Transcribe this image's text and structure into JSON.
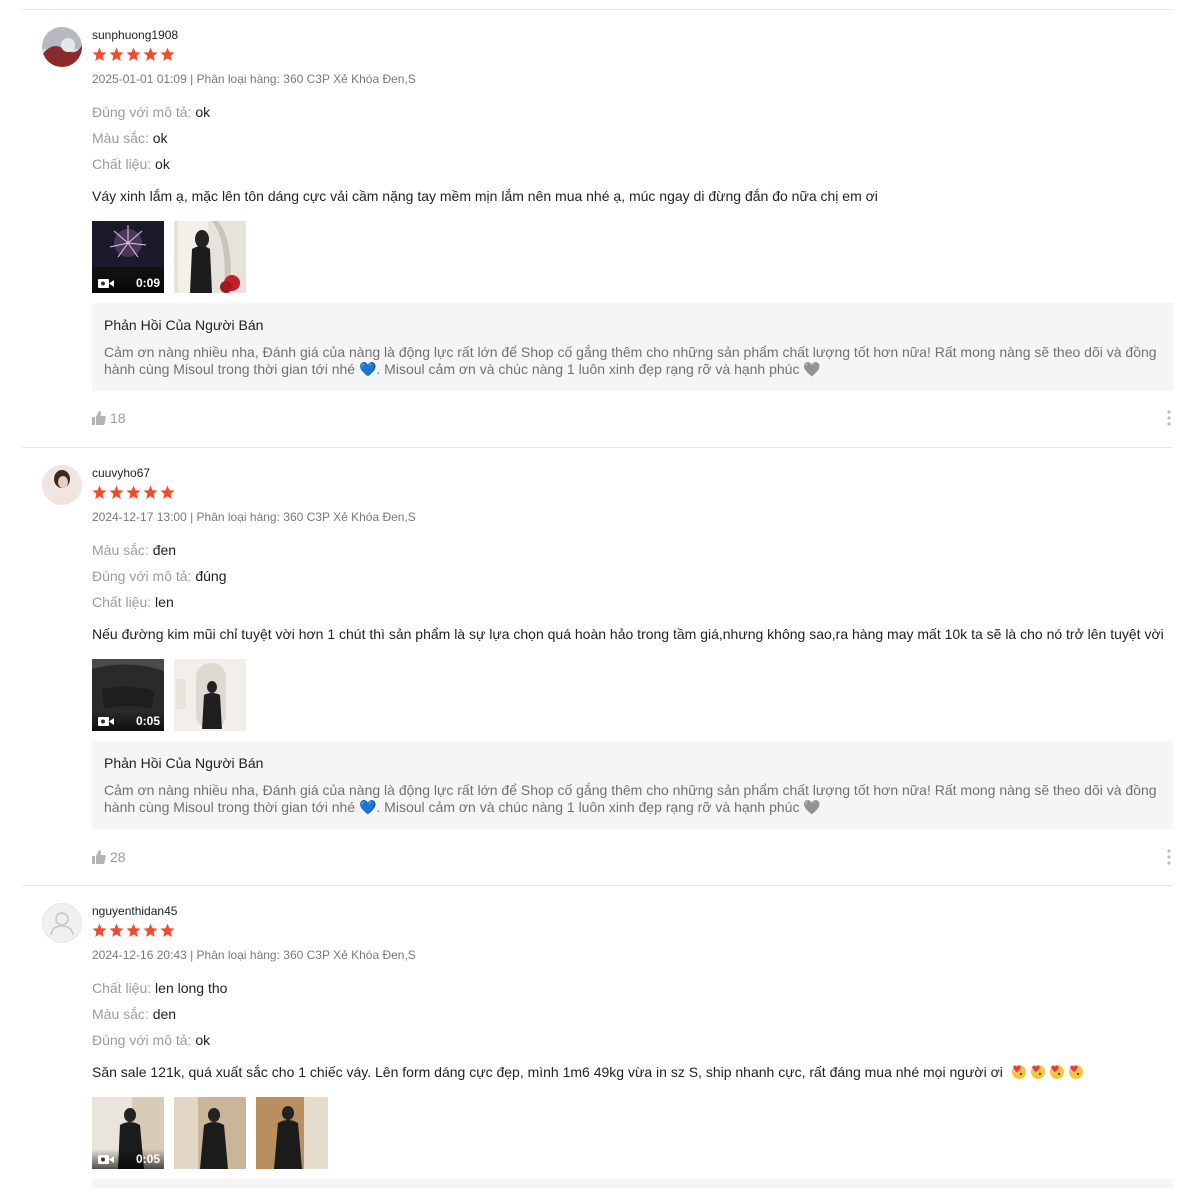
{
  "colors": {
    "star": "#ee4d2d",
    "text": "#222222",
    "muted": "#8a8a8a",
    "reply_bg": "#f5f5f5"
  },
  "reviews": [
    {
      "username": "sunphuong1908",
      "rating": 5,
      "meta": "2025-01-01 01:09 | Phân loại hàng: 360 C3P Xẻ Khóa Đen,S",
      "attributes": [
        {
          "label": "Đúng với mô tả: ",
          "value": "ok"
        },
        {
          "label": "Màu sắc: ",
          "value": "ok"
        },
        {
          "label": "Chất liệu: ",
          "value": "ok"
        }
      ],
      "comment": "Váy xinh lắm ạ, mặc lên tôn dáng cực vải cầm nặng tay mềm mịn lắm nên mua nhé ạ, múc ngay di đừng đắn đo nữa chị em ơi",
      "video_duration": "0:09",
      "media_count": 2,
      "reply": {
        "title": "Phản Hồi Của Người Bán",
        "line1": "Cảm ơn nàng nhiều nha, Đánh giá của nàng là động lực rất lớn để Shop cố gắng thêm cho những sản phẩm chất lượng tốt hơn nữa! Rất mong nàng sẽ theo dõi và đồng",
        "line2a": "hành cùng Misoul trong thời gian tới nhé ",
        "line2b": ". Misoul cảm ơn và chúc nàng 1 luôn xinh đẹp rạng rỡ và hạnh phúc ",
        "heart_blue": "💙",
        "heart_black": "🖤"
      },
      "likes": "18"
    },
    {
      "username": "cuuvyho67",
      "rating": 5,
      "meta": "2024-12-17 13:00 | Phân loại hàng: 360 C3P Xẻ Khóa Đen,S",
      "attributes": [
        {
          "label": "Màu sắc: ",
          "value": "đen"
        },
        {
          "label": "Đúng với mô tả: ",
          "value": "đúng"
        },
        {
          "label": "Chất liệu: ",
          "value": "len"
        }
      ],
      "comment": "Nếu đường kim mũi chỉ tuyệt vời hơn 1 chút thì sản phẩm là sự lựa chọn quá hoàn hảo trong tầm giá,nhưng không sao,ra hàng may mất 10k ta sẽ là cho nó trở lên tuyệt vời",
      "video_duration": "0:05",
      "media_count": 2,
      "reply": {
        "title": "Phản Hồi Của Người Bán",
        "line1": "Cảm ơn nàng nhiều nha, Đánh giá của nàng là động lực rất lớn để Shop cố gắng thêm cho những sản phẩm chất lượng tốt hơn nữa! Rất mong nàng sẽ theo dõi và đồng",
        "line2a": "hành cùng Misoul trong thời gian tới nhé ",
        "line2b": ". Misoul cảm ơn và chúc nàng 1 luôn xinh đẹp rạng rỡ và hạnh phúc ",
        "heart_blue": "💙",
        "heart_black": "🖤"
      },
      "likes": "28"
    },
    {
      "username": "nguyenthidan45",
      "rating": 5,
      "meta": "2024-12-16 20:43 | Phân loại hàng: 360 C3P Xẻ Khóa Đen,S",
      "attributes": [
        {
          "label": "Chất liệu: ",
          "value": "len long tho"
        },
        {
          "label": "Màu sắc: ",
          "value": "den"
        },
        {
          "label": "Đúng với mô tả: ",
          "value": "ok"
        }
      ],
      "comment": "Săn sale 121k, quá xuất sắc cho 1 chiếc váy. Lên form dáng cực đẹp, mình 1m6 49kg vừa in sz S, ship nhanh cực, rất đáng mua nhé mọi người ơi",
      "video_duration": "0:05",
      "media_count": 3,
      "emoji_count": 4
    }
  ]
}
